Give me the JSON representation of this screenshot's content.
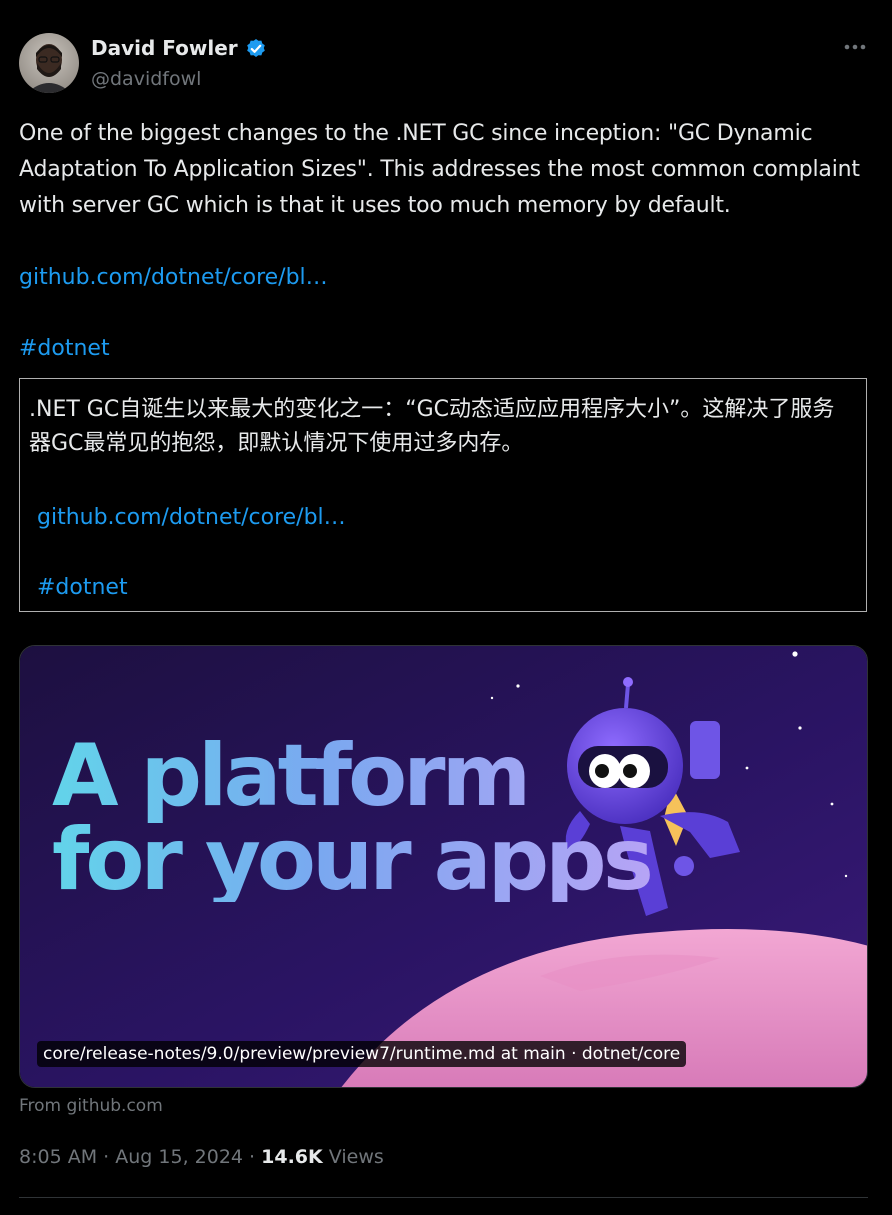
{
  "author": {
    "name": "David Fowler",
    "handle": "@davidfowl",
    "verified": true,
    "verified_color": "#1d9bf0"
  },
  "more_icon": "more-horizontal-icon",
  "tweet": {
    "text": "One of the biggest changes to the .NET GC since inception: \"GC Dynamic Adaptation To Application Sizes\". This addresses the most common complaint with server GC which is that it uses too much memory by default.",
    "link": "github.com/dotnet/core/bl…",
    "hashtag": "#dotnet"
  },
  "translation": {
    "text": ".NET GC自诞生以来最大的变化之一：“GC动态适应应用程序大小”。这解决了服务器GC最常见的抱怨，即默认情况下使用过多内存。",
    "link": "github.com/dotnet/core/bl…",
    "hashtag": "#dotnet"
  },
  "card": {
    "headline_line1": "A platform",
    "headline_line2": "for your apps",
    "caption": "core/release-notes/9.0/preview/preview7/runtime.md at main · dotnet/core",
    "source": "From github.com"
  },
  "meta": {
    "time": "8:05 AM",
    "separator": "·",
    "date": "Aug 15, 2024",
    "views_count": "14.6K",
    "views_label": "Views"
  },
  "colors": {
    "background": "#000000",
    "text": "#e7e9ea",
    "muted": "#71767b",
    "link": "#1d9bf0"
  }
}
